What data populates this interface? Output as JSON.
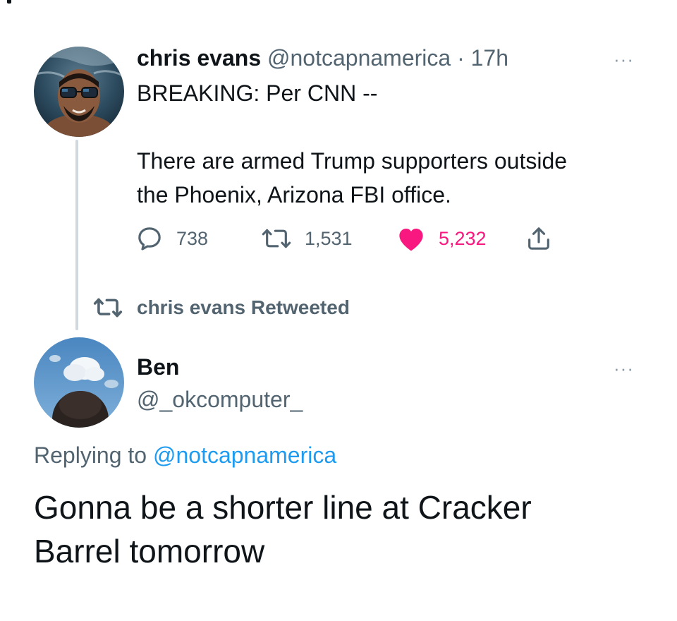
{
  "original_tweet": {
    "author": {
      "display_name": "chris evans",
      "handle": "@notcapnamerica",
      "separator": "·",
      "time": "17h"
    },
    "more_label": "···",
    "text_lines": [
      "BREAKING: Per CNN --",
      "There are armed Trump supporters outside",
      "the Phoenix, Arizona FBI office."
    ],
    "actions": {
      "replies": "738",
      "retweets": "1,531",
      "likes": "5,232"
    },
    "colors": {
      "like": "#f91880",
      "muted": "#536471"
    }
  },
  "retweet_banner": {
    "label": "chris evans Retweeted"
  },
  "reply_tweet": {
    "author": {
      "display_name": "Ben",
      "handle": "@_okcomputer_"
    },
    "more_label": "···",
    "replying_to_prefix": "Replying to",
    "replying_to_handle": "@notcapnamerica",
    "text_lines": [
      "Gonna be a shorter line at Cracker",
      "Barrel tomorrow"
    ],
    "colors": {
      "mention": "#1d9bf0"
    }
  },
  "icons": {
    "reply": "reply-icon",
    "retweet": "retweet-icon",
    "like": "heart-icon",
    "share": "share-icon"
  }
}
